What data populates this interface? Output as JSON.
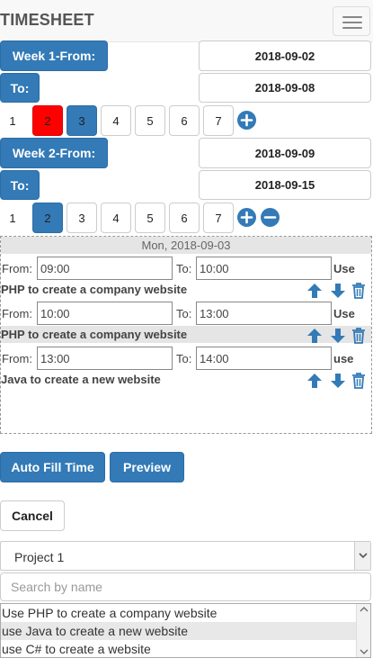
{
  "navbar": {
    "brand": "TIMESHEET"
  },
  "week1": {
    "from_label": "Week 1-From:",
    "from_date": "2018-09-02",
    "to_label": "To:",
    "to_date": "2018-09-08",
    "days": [
      "1",
      "2",
      "3",
      "4",
      "5",
      "6",
      "7"
    ]
  },
  "week2": {
    "from_label": "Week 2-From:",
    "from_date": "2018-09-09",
    "to_label": "To:",
    "to_date": "2018-09-15",
    "days": [
      "1",
      "2",
      "3",
      "4",
      "5",
      "6",
      "7"
    ]
  },
  "day_panel": {
    "header": "Mon, 2018-09-03",
    "entries": [
      {
        "from_label": "From:",
        "from": "09:00",
        "to_label": "To:",
        "to": "10:00",
        "use": "Use",
        "task": "PHP to create a company website"
      },
      {
        "from_label": "From:",
        "from": "10:00",
        "to_label": "To:",
        "to": "13:00",
        "use": "Use",
        "task": "PHP to create a company website"
      },
      {
        "from_label": "From:",
        "from": "13:00",
        "to_label": "To:",
        "to": "14:00",
        "use": "use",
        "task": "Java to create a new website"
      }
    ]
  },
  "actions": {
    "auto_fill": "Auto Fill Time",
    "preview": "Preview",
    "cancel": "Cancel"
  },
  "project_select": {
    "selected": "Project 1"
  },
  "search": {
    "placeholder": "Search by name"
  },
  "task_list": [
    "Use PHP to create a company website",
    "use Java to create a new website",
    "use C# to create a website"
  ],
  "colors": {
    "primary": "#337ab7",
    "active_red": "#ff0000"
  },
  "icons": {
    "add": "plus-circle-icon",
    "remove": "minus-circle-icon",
    "up": "arrow-up-icon",
    "down": "arrow-down-icon",
    "delete": "trash-icon",
    "menu": "hamburger-icon"
  }
}
